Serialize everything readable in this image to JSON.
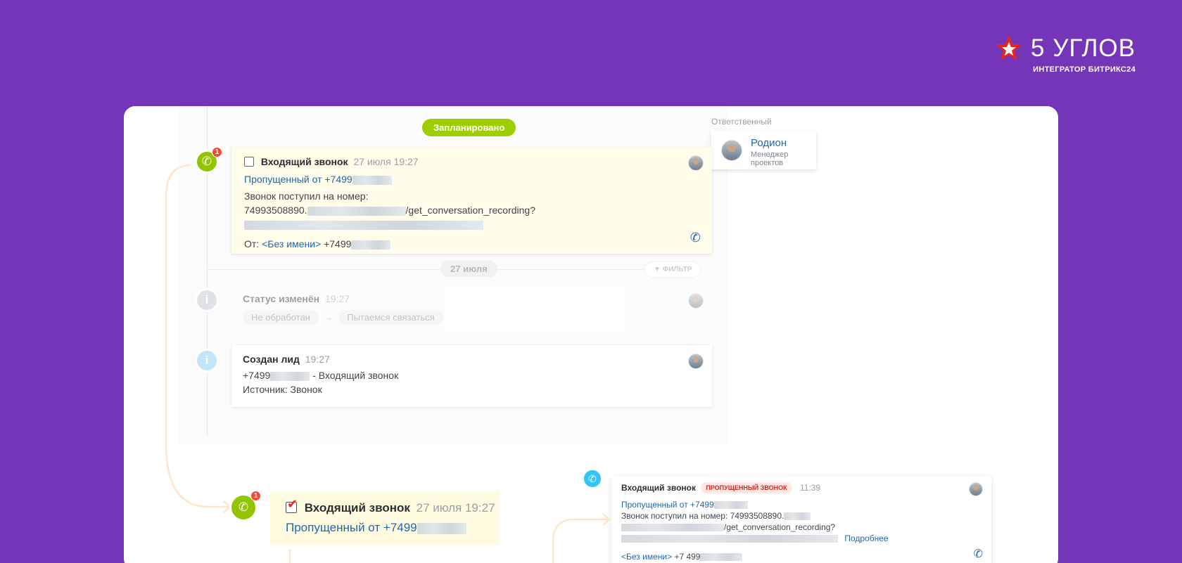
{
  "brand": {
    "title": "5 УГЛОВ",
    "subtitle": "ИНТЕГРАТОР БИТРИКС24",
    "logo_color": "#e8241b"
  },
  "colors": {
    "background": "#7535b8",
    "accent_green": "#92c500",
    "link_blue": "#2067b0",
    "badge_red": "#f44a35"
  },
  "timeline": {
    "planned_label": "Запланировано",
    "responsible": {
      "label": "Ответственный",
      "name": "Родион",
      "role": "Менеджер проектов"
    },
    "call_item": {
      "badge": "1",
      "title": "Входящий звонок",
      "time": "27 июля 19:27",
      "missed": "Пропущенный от +7499",
      "call_to": "Звонок поступил на номер:",
      "number_prefix": "74993508890.",
      "url_suffix": "/get_conversation_recording?",
      "from_label": "От:",
      "from_name": "<Без имени>",
      "from_phone": "+7499"
    },
    "date_separator": "27 июля",
    "filter_label": "ФИЛЬТР",
    "status_item": {
      "title": "Статус изменён",
      "time": "19:27",
      "from": "Не обработан",
      "arrow": "→",
      "to": "Пытаемся связаться"
    },
    "lead_item": {
      "title": "Создан лид",
      "time": "19:27",
      "phone": "+7499",
      "phone_suffix": "- Входящий звонок",
      "source": "Источник: Звонок"
    }
  },
  "zoom": {
    "badge": "1",
    "title": "Входящий звонок",
    "time": "27 июля 19:27",
    "missed": "Пропущенный от +7499"
  },
  "call_detail": {
    "title": "Входящий звонок",
    "status_chip": "ПРОПУЩЕННЫЙ ЗВОНОК",
    "time": "11:39",
    "missed": "Пропущенный от +7499",
    "call_to": "Звонок поступил на номер: 74993508890.",
    "url_suffix": "/get_conversation_recording?",
    "more_link": "Подробнее",
    "from_name": "<Без имени>",
    "from_phone": "+7 499"
  }
}
